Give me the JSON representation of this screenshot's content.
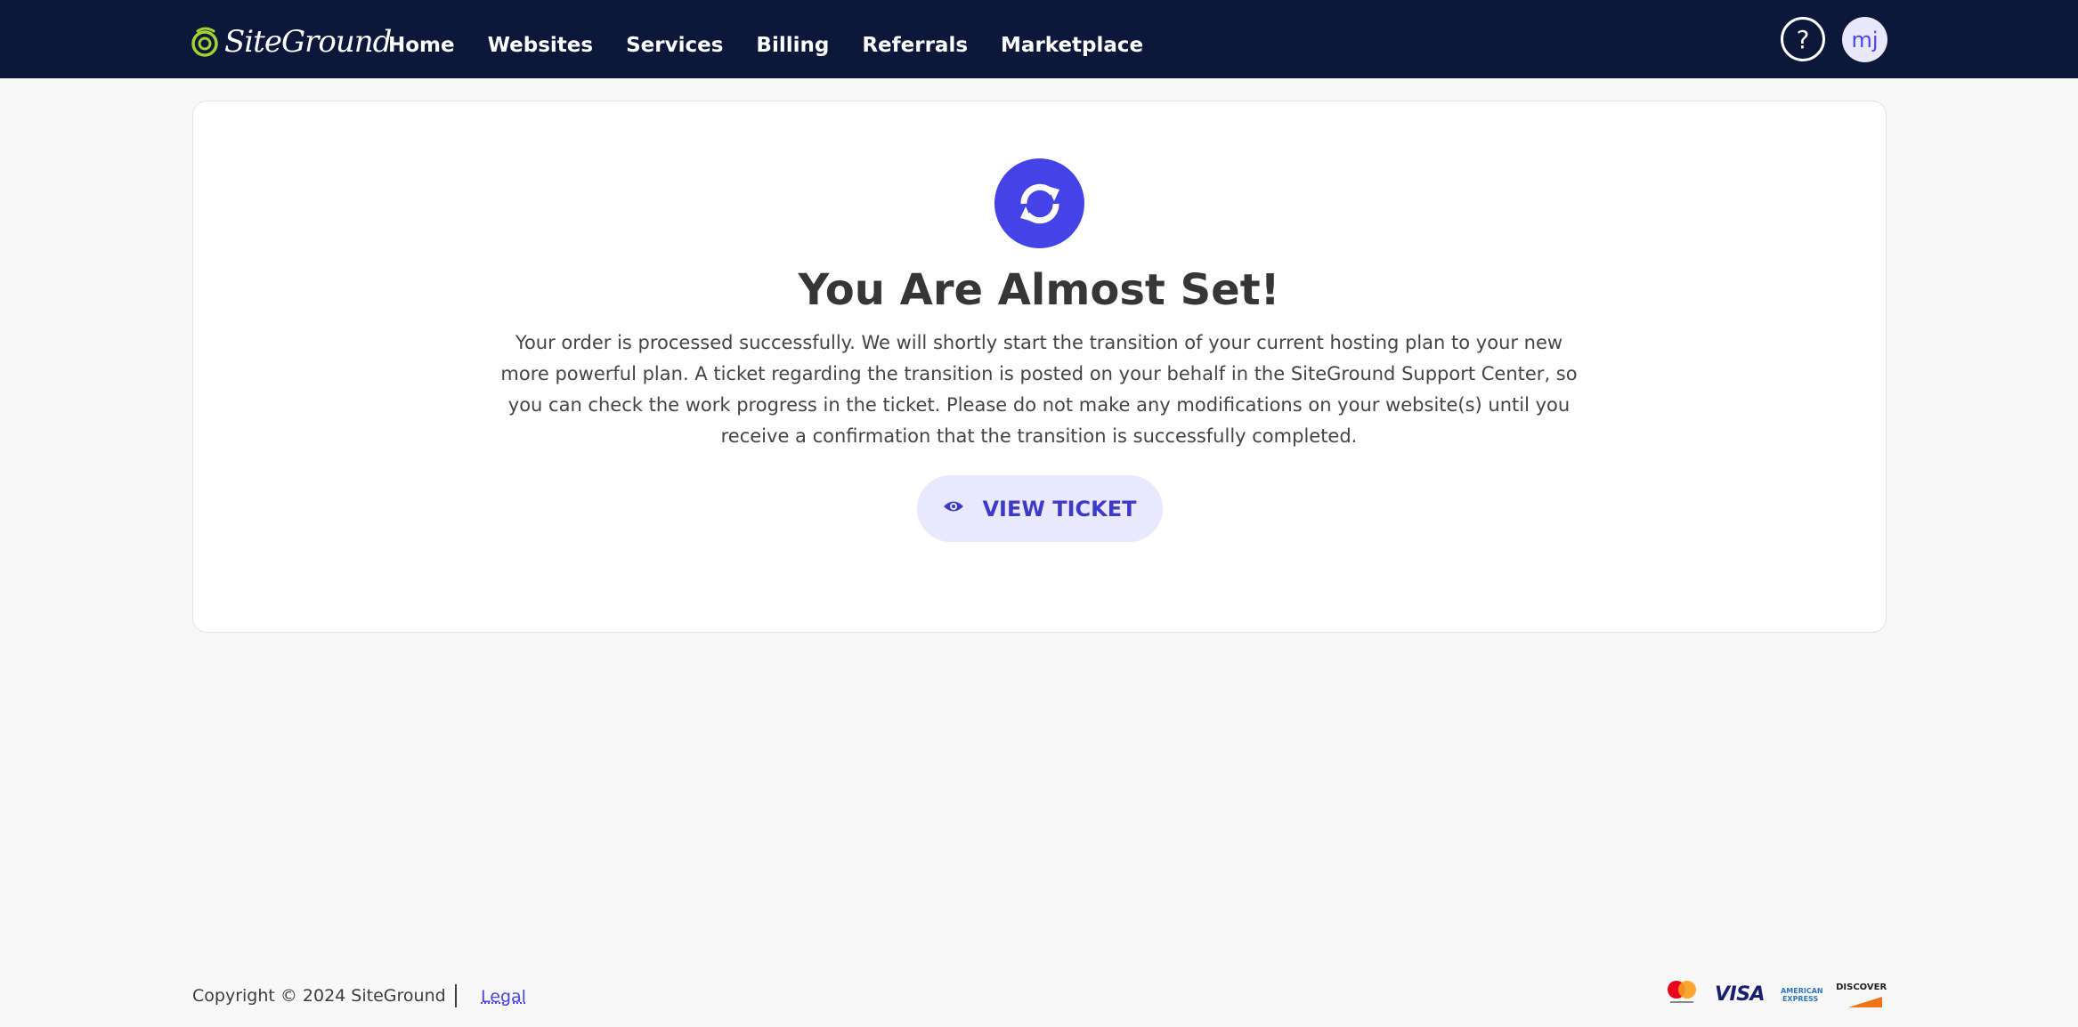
{
  "header": {
    "logo_text": "SiteGround",
    "logo_icon": "siteground-logo-icon",
    "nav": [
      {
        "label": "Home"
      },
      {
        "label": "Websites"
      },
      {
        "label": "Services"
      },
      {
        "label": "Billing"
      },
      {
        "label": "Referrals"
      },
      {
        "label": "Marketplace"
      }
    ],
    "help_label": "?",
    "avatar_initials": "mj",
    "background": "#0c1739"
  },
  "main": {
    "status_icon": "sync-icon",
    "title": "You Are Almost Set!",
    "message": "Your order is processed successfully. We will shortly start the transition of your current hosting plan to your new more powerful plan. A ticket regarding the transition is posted on your behalf in the SiteGround Support Center, so you can check the work progress in the ticket. Please do not make any modifications on your website(s) until you receive a confirmation that the transition is successfully completed.",
    "view_ticket_label": "VIEW TICKET",
    "view_ticket_icon": "eye-icon",
    "accent": "#4343e8"
  },
  "footer": {
    "copyright": "Copyright © 2024 SiteGround",
    "legal_label": "Legal",
    "payment_methods": [
      "mastercard-icon",
      "visa-icon",
      "amex-icon",
      "discover-icon"
    ],
    "visa_text": "VISA",
    "amex_text": "AMERICAN EXPRESS",
    "discover_text": "DISCOVER"
  }
}
